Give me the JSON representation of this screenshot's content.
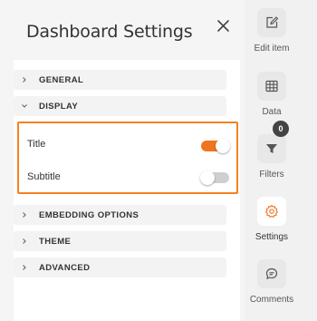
{
  "panel": {
    "title": "Dashboard Settings",
    "close_icon": "close-icon"
  },
  "sections": {
    "general": "GENERAL",
    "display": "DISPLAY",
    "embedding": "EMBEDDING OPTIONS",
    "theme": "THEME",
    "advanced": "ADVANCED"
  },
  "display_options": {
    "title": {
      "label": "Title",
      "enabled": true
    },
    "subtitle": {
      "label": "Subtitle",
      "enabled": false
    }
  },
  "rail": {
    "edit_item": "Edit item",
    "data": "Data",
    "filters": "Filters",
    "filters_badge": "0",
    "settings": "Settings",
    "comments": "Comments"
  },
  "colors": {
    "accent": "#f58220",
    "toggle_on": "#f0741e",
    "toggle_off": "#cfcfcf"
  }
}
